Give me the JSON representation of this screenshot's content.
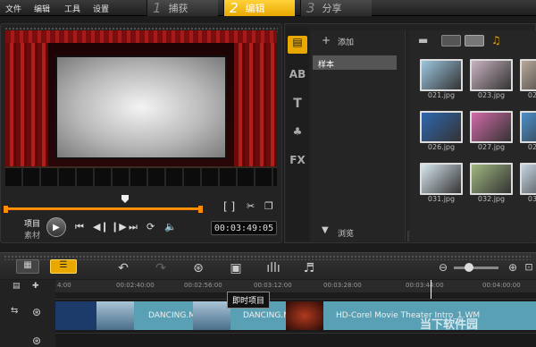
{
  "menu": [
    "文件",
    "编辑",
    "工具",
    "设置"
  ],
  "steps": [
    {
      "num": "1",
      "label": "捕获"
    },
    {
      "num": "2",
      "label": "编辑"
    },
    {
      "num": "3",
      "label": "分享"
    }
  ],
  "preview": {
    "mode_project": "项目",
    "mode_clip": "素材",
    "timecode": "00:03:49:05",
    "brackets": "[   ]"
  },
  "library": {
    "side_icons": [
      "AB",
      "T",
      "FX"
    ],
    "add_label": "添加",
    "sample_folder": "样本",
    "browse_label": "浏览",
    "thumbs": [
      {
        "label": "021.jpg",
        "color": "#9cc6e0"
      },
      {
        "label": "023.jpg",
        "color": "#c9b3c0"
      },
      {
        "label": "024.jpg",
        "color": "#b8a898"
      },
      {
        "label": "026.jpg",
        "color": "#2f67b0"
      },
      {
        "label": "027.jpg",
        "color": "#d46aa8"
      },
      {
        "label": "028.jpg",
        "color": "#4c8fc9"
      },
      {
        "label": "031.jpg",
        "color": "#d9e7f0"
      },
      {
        "label": "032.jpg",
        "color": "#9fb77f"
      },
      {
        "label": "034.jpg",
        "color": "#c6d6e4"
      }
    ]
  },
  "timeline": {
    "ruler": [
      "4:00",
      "00:02:40:00",
      "00:02:56:00",
      "00:03:12:00",
      "00:03:28:00",
      "00:03:44:00",
      "00:04:00:00"
    ],
    "tooltip": "即时项目",
    "clips": [
      {
        "label": "",
        "color": "#1c3a6a"
      },
      {
        "label": "",
        "color": "#5b86a8"
      },
      {
        "label": "DANCING.M",
        "color": "#5aa0b5"
      },
      {
        "label": "",
        "color": "#5b86a8"
      },
      {
        "label": "DANCING.M",
        "color": "#5aa0b5"
      },
      {
        "label": "",
        "color": "#8a2a1a"
      },
      {
        "label": "HD-Corel Movie Theater Intro_1.WM",
        "color": "#5aa0b5"
      }
    ]
  },
  "watermark": "当下软件园"
}
